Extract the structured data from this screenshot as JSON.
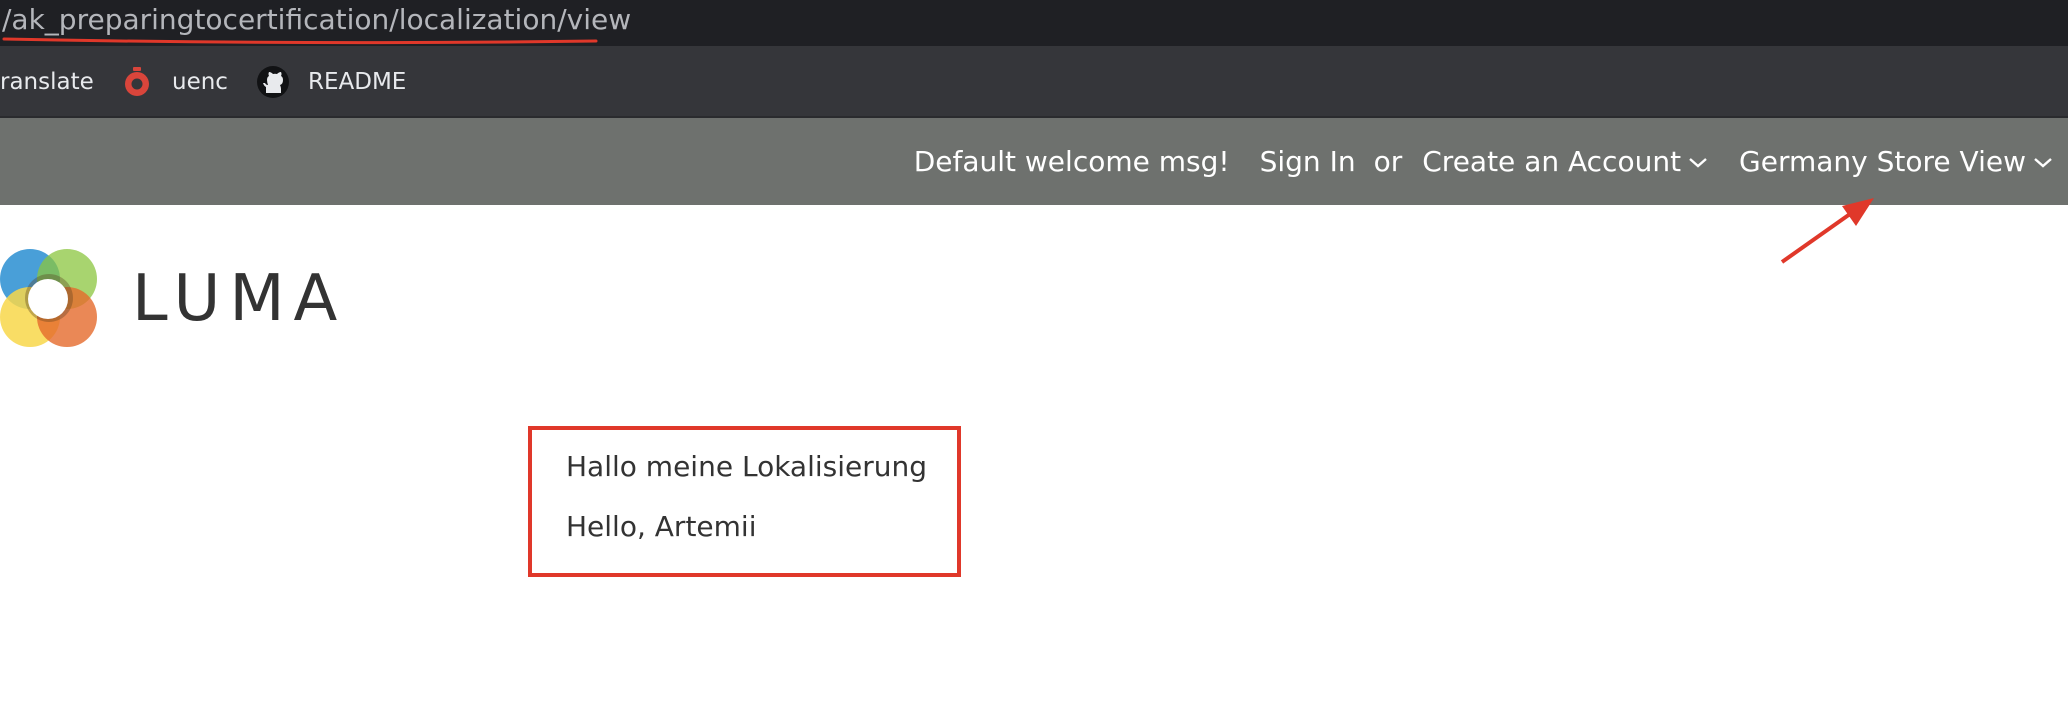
{
  "browser": {
    "address_text": "/ak_preparingtocertification/localization/view",
    "annotation_color": "#e0382a"
  },
  "bookmarks": [
    {
      "label": "ranslate",
      "icon": "translate-icon"
    },
    {
      "label": "uenc",
      "icon": "stopwatch-icon"
    },
    {
      "label": "README",
      "icon": "github-icon"
    }
  ],
  "header": {
    "welcome": "Default welcome msg!",
    "sign_in": "Sign In",
    "or": "or",
    "create_account": "Create an Account",
    "store_view": "Germany Store View",
    "background": "#6e716e"
  },
  "logo": {
    "text": "LUMA"
  },
  "content": {
    "line1": "Hallo meine Lokalisierung",
    "line2": "Hello, Artemii"
  }
}
